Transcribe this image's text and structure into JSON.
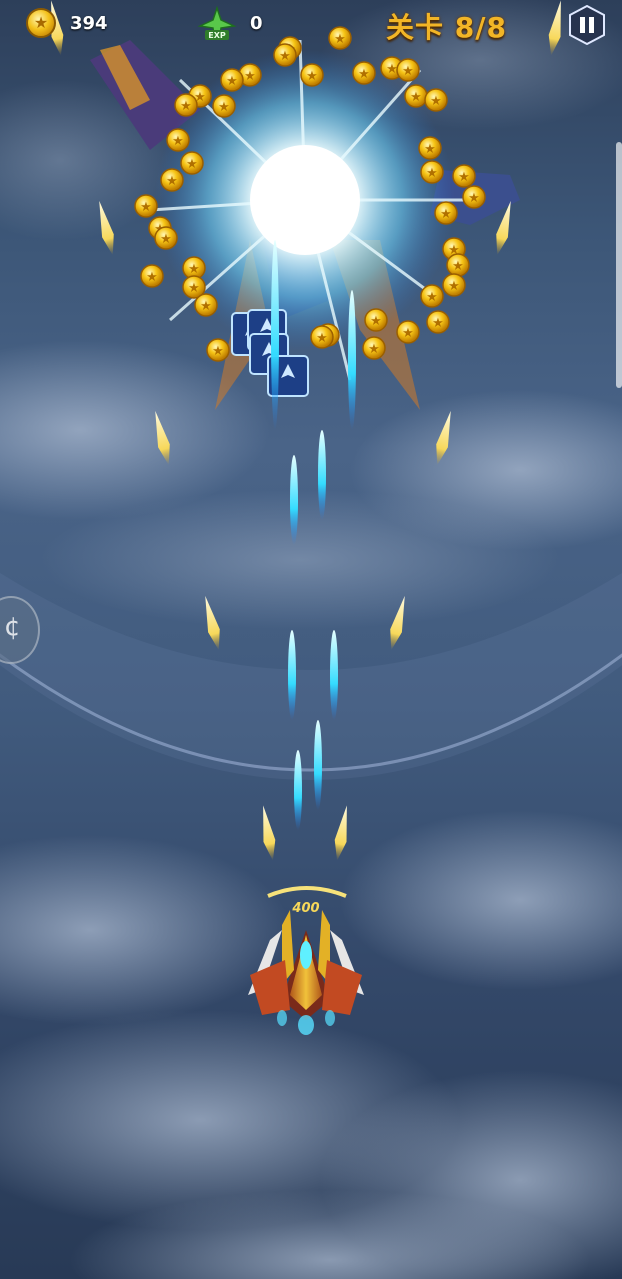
{
  "hud": {
    "coins": "394",
    "exp_label": "EXP",
    "exp": "0",
    "level": "关卡 8/8",
    "pause_label": "pause"
  },
  "player": {
    "power": "400"
  },
  "colors": {
    "gold": "#f2b526",
    "laser": "#3fe6ff",
    "flare": "#ffffff",
    "sky": "#4a6488"
  },
  "icons": [
    "coin-icon",
    "exp-plane-icon",
    "pause-icon",
    "powerup-plane-icon"
  ]
}
